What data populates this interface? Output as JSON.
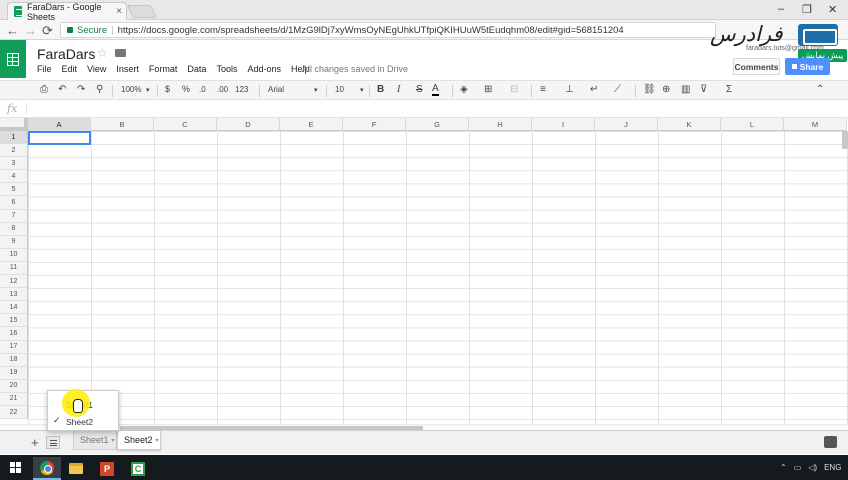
{
  "browser": {
    "tab_title": "FaraDars - Google Sheets",
    "tab_close": "×",
    "url_secure_label": "Secure",
    "url": "https://docs.google.com/spreadsheets/d/1MzG9lDj7xyWmsOyNEgUhkUTfpiQKIHUuW5tEudqhm08/edit#gid=568151204",
    "window_min": "–",
    "window_max": "❐",
    "window_close": "✕",
    "back": "←",
    "forward": "→",
    "reload": "⟳",
    "star": "☆",
    "more": "⋮"
  },
  "doc": {
    "title": "FaraDars",
    "star": "☆",
    "saved_status": "All changes saved in Drive",
    "menu": [
      "File",
      "Edit",
      "View",
      "Insert",
      "Format",
      "Data",
      "Tools",
      "Add-ons",
      "Help"
    ],
    "comments_label": "Comments",
    "share_label": "Share",
    "user_email": "faradars.tuts@gmail.com"
  },
  "watermark": {
    "logo_text": "فرادرس",
    "badge_text": "پیش نمایش"
  },
  "toolbar": {
    "print": "⎙",
    "undo": "↶",
    "redo": "↷",
    "paint_format": "⚲",
    "zoom": "100%",
    "currency": "$",
    "percent": "%",
    "decrease_decimal": ".0",
    "increase_decimal": ".00",
    "more_formats": "123",
    "font": "Arial",
    "font_size": "10",
    "bold": "B",
    "italic": "I",
    "strikethrough": "S",
    "text_color": "A",
    "fill": "◈",
    "borders": "⊞",
    "merge": "⊟",
    "halign": "≡",
    "valign": "⊥",
    "wrap": "↵",
    "rotate": "⟋",
    "link": "⛓",
    "comment": "⊕",
    "chart": "▥",
    "filter": "⊽",
    "functions": "Σ",
    "collapse": "⌃",
    "caret": "▾"
  },
  "formula_bar": {
    "fx_label": "fx",
    "value": ""
  },
  "grid": {
    "columns": [
      "A",
      "B",
      "C",
      "D",
      "E",
      "F",
      "G",
      "H",
      "I",
      "J",
      "K",
      "L",
      "M"
    ],
    "rows": [
      "1",
      "2",
      "3",
      "4",
      "5",
      "6",
      "7",
      "8",
      "9",
      "10",
      "11",
      "12",
      "13",
      "14",
      "15",
      "16",
      "17",
      "18",
      "19",
      "20",
      "21",
      "22"
    ],
    "active_cell": "A1"
  },
  "sheets": {
    "add": "+",
    "tabs": [
      "Sheet1",
      "Sheet2"
    ],
    "active_tab": "Sheet2",
    "menu_items": [
      "Sheet1",
      "Sheet2"
    ],
    "menu_checked": "Sheet2",
    "check": "✓"
  },
  "taskbar": {
    "ppt_letter": "P",
    "camtasia_letter": "C",
    "lang": "ENG",
    "tray_up": "⌃",
    "tray_net": "▭",
    "tray_vol": "◁)"
  },
  "colors": {
    "sheets_green": "#0f9d58",
    "share_blue": "#4d90fe",
    "selection_blue": "#4285f4",
    "highlight_yellow": "#ffec00"
  }
}
